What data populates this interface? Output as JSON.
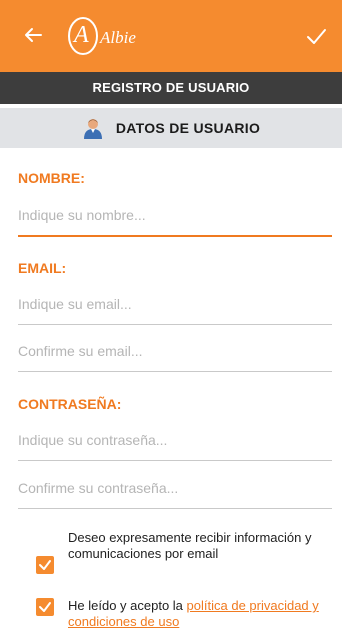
{
  "appbar": {
    "logo_mark": "A",
    "logo_text": "Albie",
    "back_icon": "arrow-left-icon",
    "confirm_icon": "check-icon",
    "color": "#f58b2f"
  },
  "title": "REGISTRO DE USUARIO",
  "section": {
    "title": "DATOS DE USUARIO",
    "icon": "user-avatar-icon"
  },
  "form": {
    "name_label": "NOMBRE:",
    "name_placeholder": "Indique su nombre...",
    "email_label": "EMAIL:",
    "email_placeholder": "Indique su email...",
    "email_confirm_placeholder": "Confirme su email...",
    "password_label": "CONTRASEÑA:",
    "password_placeholder": "Indique su contraseña...",
    "password_confirm_placeholder": "Confirme su contraseña..."
  },
  "consents": {
    "marketing_text": "Deseo expresamente recibir información y comunicaciones por email",
    "privacy_prefix": "He leído y acepto la ",
    "privacy_link": "política de privacidad y condiciones de uso",
    "marketing_checked": true,
    "privacy_checked": true
  },
  "colors": {
    "accent": "#f58b2f",
    "label": "#f07a20",
    "titlebar": "#3d3d3d",
    "section": "#e1e3e6"
  }
}
